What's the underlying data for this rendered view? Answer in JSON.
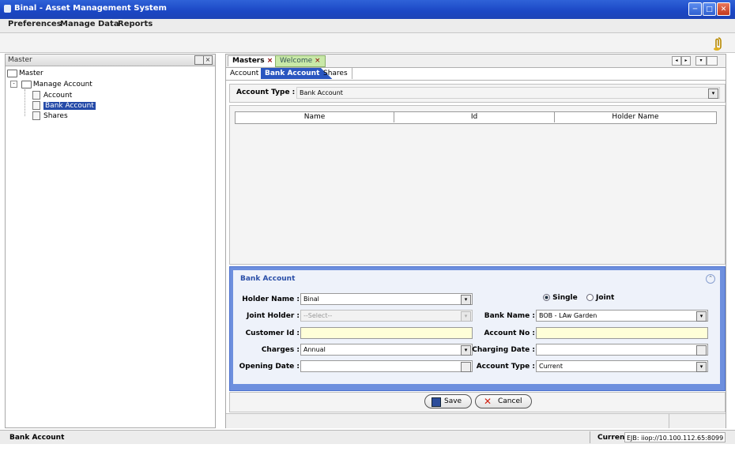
{
  "window": {
    "title": "Binal - Asset Management System"
  },
  "menu": [
    "Preferences",
    "Manage Data",
    "Reports"
  ],
  "master_panel": {
    "title": "Master",
    "tree": {
      "root": "Master",
      "group": "Manage Account",
      "items": [
        "Account",
        "Bank Account",
        "Shares"
      ],
      "selected": "Bank Account"
    }
  },
  "tabs": {
    "main": [
      "Masters",
      "Welcome"
    ],
    "sub": [
      "Account",
      "Bank Account",
      "Shares"
    ],
    "active_sub": "Bank Account"
  },
  "filter": {
    "label": "Account Type :",
    "value": "Bank Account"
  },
  "table": {
    "columns": [
      "Name",
      "Id",
      "Holder Name"
    ],
    "rows": []
  },
  "form": {
    "title": "Bank Account",
    "holder_name": {
      "label": "Holder Name :",
      "value": "Binal"
    },
    "joint_holder": {
      "label": "Joint Holder :",
      "value": "--Select--"
    },
    "customer_id": {
      "label": "Customer Id :",
      "value": ""
    },
    "charges": {
      "label": "Charges :",
      "value": "Annual"
    },
    "opening_date": {
      "label": "Opening Date :",
      "value": ""
    },
    "holding_type": {
      "options": [
        "Single",
        "Joint"
      ],
      "selected": "Single"
    },
    "bank_name": {
      "label": "Bank Name :",
      "value": "BOB - LAw Garden"
    },
    "account_no": {
      "label": "Account No :",
      "value": ""
    },
    "charging_date": {
      "label": "Charging Date :",
      "value": ""
    },
    "account_type": {
      "label": "Account Type :",
      "value": "Current"
    }
  },
  "buttons": {
    "save": "Save",
    "cancel": "Cancel"
  },
  "status": {
    "left": "Bank Account",
    "mode": "Current",
    "connection": "EJB: iiop://10.100.112.65:8099"
  },
  "colors": {
    "titlebar": "#1b47c4",
    "form_bg": "#eef2fa",
    "form_border": "#4d72cf",
    "selection": "#244aa8",
    "required_field": "#ffffd8"
  }
}
